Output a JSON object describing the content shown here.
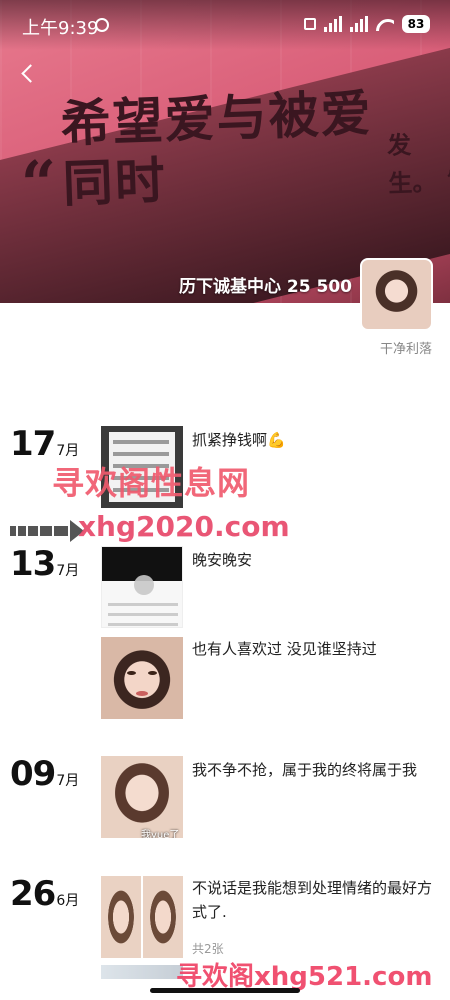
{
  "status_bar": {
    "time": "上午9:39",
    "battery": "83"
  },
  "cover": {
    "slogan_open_quote": "“",
    "slogan_big": "希望爱与被爱同时",
    "slogan_small": "发生。",
    "slogan_close_quote": "”",
    "caption": "历下诚基中心 25 500"
  },
  "profile": {
    "username": "干净利落"
  },
  "posts": [
    {
      "day": "17",
      "month": "7月",
      "text": "抓紧挣钱啊💪",
      "count": ""
    },
    {
      "day": "13",
      "month": "7月",
      "text": "晚安晚安",
      "count": ""
    },
    {
      "day": "",
      "month": "",
      "text": "也有人喜欢过 没见谁坚持过",
      "count": ""
    },
    {
      "day": "09",
      "month": "7月",
      "text": "我不争不抢，属于我的终将属于我",
      "count": "",
      "thumb_caption": "我yue了"
    },
    {
      "day": "26",
      "month": "6月",
      "text": "不说话是我能想到处理情绪的最好方式了.",
      "count": "共2张"
    }
  ],
  "watermarks": {
    "site_name": "寻欢阁性息网",
    "url1": "xhg2020.com",
    "url2": "寻欢阁xhg521.com"
  },
  "colors": {
    "cover_pink": "#d95f79",
    "watermark_red": "#f05b6e"
  }
}
